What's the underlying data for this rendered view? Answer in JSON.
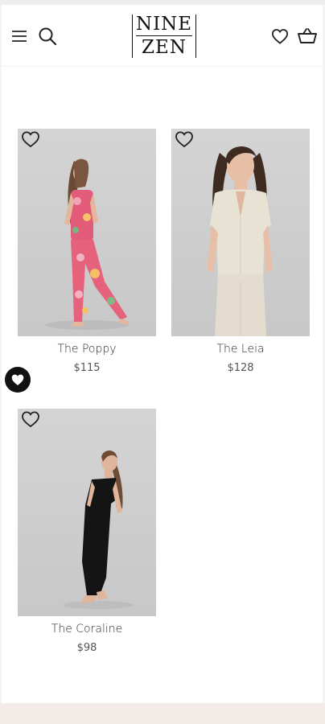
{
  "brand": {
    "logo_line1": "NINE",
    "logo_line2": "ZEN"
  },
  "header_icons": {
    "menu": "menu-icon",
    "search": "search-icon",
    "wishlist": "heart-outline-icon",
    "cart": "basket-icon"
  },
  "products": [
    {
      "name": "The Poppy",
      "price": "$115",
      "swatch": "#e8607a"
    },
    {
      "name": "The Leia",
      "price": "$128",
      "swatch": "#e9e3d6"
    },
    {
      "name": "The Coraline",
      "price": "$98",
      "swatch": "#111111"
    }
  ],
  "colors": {
    "accent": "#111111",
    "photo_background": "#cfcfcf",
    "footer_band": "#f3ebe8"
  }
}
